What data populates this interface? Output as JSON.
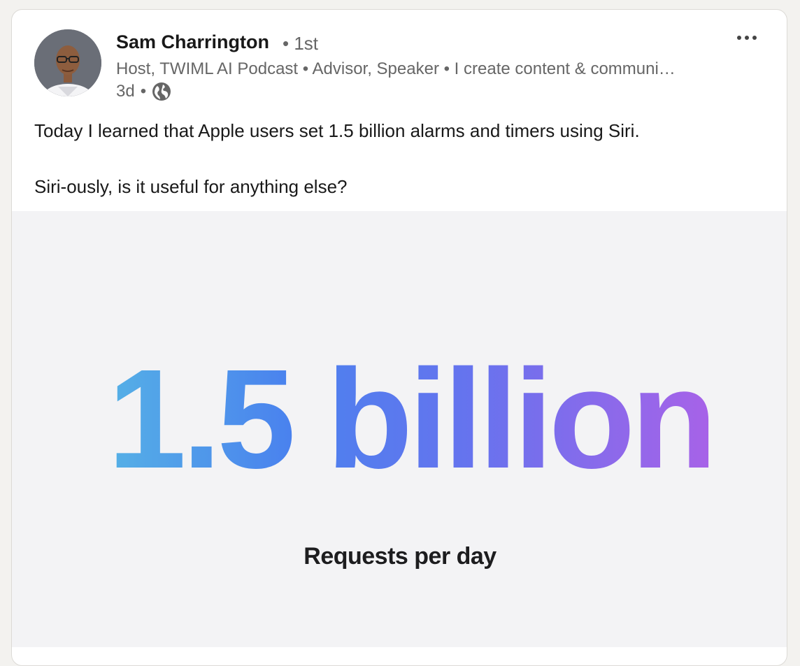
{
  "post": {
    "author": {
      "name": "Sam Charrington",
      "degree": "• 1st",
      "headline": "Host, TWIML AI Podcast • Advisor, Speaker • I create content & communi…",
      "time": "3d",
      "separator": "•",
      "visibility_icon": "globe-icon"
    },
    "menu_icon": "more-options-icon",
    "text": {
      "line1": "Today I learned that Apple users set 1.5 billion alarms and timers using Siri.",
      "line2": "Siri-ously, is it useful for anything else?"
    },
    "image": {
      "headline": "1.5 billion",
      "caption": "Requests per day",
      "gradient_colors": [
        "#55b0e6",
        "#4a82ee",
        "#6673ee",
        "#a862e8"
      ],
      "background": "#f3f3f5"
    }
  }
}
